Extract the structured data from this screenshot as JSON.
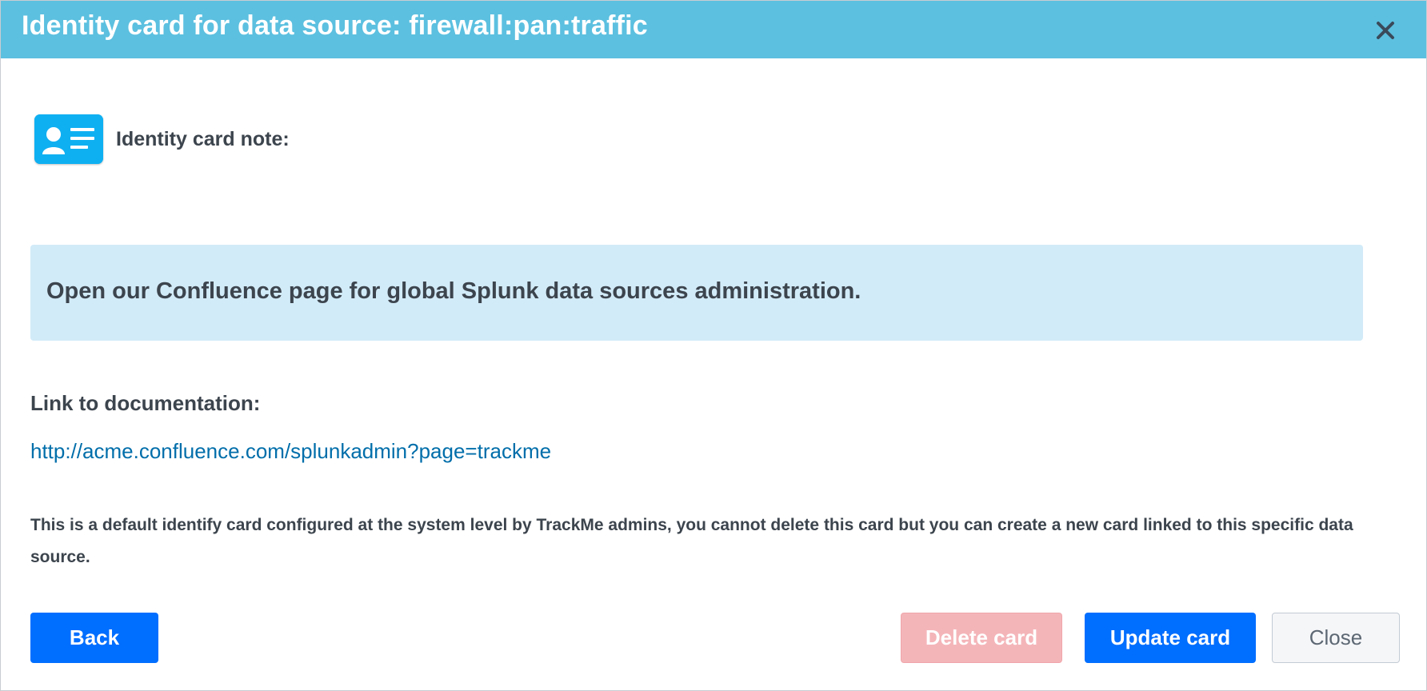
{
  "dialog": {
    "title": "Identity card for data source: firewall:pan:traffic",
    "close_icon": "close-x-icon"
  },
  "card": {
    "icon": "id-card-icon",
    "icon_color": "#0fb0f2",
    "note_label": "Identity card note:",
    "note_text": "Open our Confluence page for global Splunk data sources administration.",
    "doc_label": "Link to documentation:",
    "doc_link": "http://acme.confluence.com/splunkadmin?page=trackme",
    "info_text": "This is a default identify card configured at the system level by TrackMe admins, you cannot delete this card but you can create a new card linked to this specific data source."
  },
  "buttons": {
    "back": "Back",
    "delete": "Delete card",
    "update": "Update card",
    "close": "Close"
  },
  "colors": {
    "header": "#5cc0e0",
    "primary": "#006eff",
    "danger_disabled": "#f4b5b9",
    "note_background": "#d2ebf8",
    "link": "#006eaa"
  }
}
